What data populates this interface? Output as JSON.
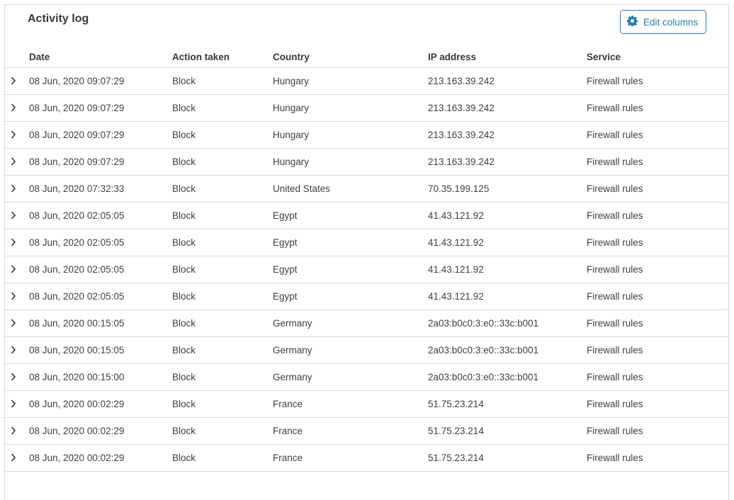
{
  "header": {
    "title": "Activity log",
    "edit_columns_label": "Edit columns",
    "edit_columns_icon": "gear-icon",
    "accent_color": "#2c7cb0"
  },
  "table": {
    "columns": [
      "Date",
      "Action taken",
      "Country",
      "IP address",
      "Service"
    ],
    "rows": [
      {
        "date": "08 Jun, 2020 09:07:29",
        "action": "Block",
        "country": "Hungary",
        "ip": "213.163.39.242",
        "service": "Firewall rules"
      },
      {
        "date": "08 Jun, 2020 09:07:29",
        "action": "Block",
        "country": "Hungary",
        "ip": "213.163.39.242",
        "service": "Firewall rules"
      },
      {
        "date": "08 Jun, 2020 09:07:29",
        "action": "Block",
        "country": "Hungary",
        "ip": "213.163.39.242",
        "service": "Firewall rules"
      },
      {
        "date": "08 Jun, 2020 09:07:29",
        "action": "Block",
        "country": "Hungary",
        "ip": "213.163.39.242",
        "service": "Firewall rules"
      },
      {
        "date": "08 Jun, 2020 07:32:33",
        "action": "Block",
        "country": "United States",
        "ip": "70.35.199.125",
        "service": "Firewall rules"
      },
      {
        "date": "08 Jun, 2020 02:05:05",
        "action": "Block",
        "country": "Egypt",
        "ip": "41.43.121.92",
        "service": "Firewall rules"
      },
      {
        "date": "08 Jun, 2020 02:05:05",
        "action": "Block",
        "country": "Egypt",
        "ip": "41.43.121.92",
        "service": "Firewall rules"
      },
      {
        "date": "08 Jun, 2020 02:05:05",
        "action": "Block",
        "country": "Egypt",
        "ip": "41.43.121.92",
        "service": "Firewall rules"
      },
      {
        "date": "08 Jun, 2020 02:05:05",
        "action": "Block",
        "country": "Egypt",
        "ip": "41.43.121.92",
        "service": "Firewall rules"
      },
      {
        "date": "08 Jun, 2020 00:15:05",
        "action": "Block",
        "country": "Germany",
        "ip": "2a03:b0c0:3:e0::33c:b001",
        "service": "Firewall rules"
      },
      {
        "date": "08 Jun, 2020 00:15:05",
        "action": "Block",
        "country": "Germany",
        "ip": "2a03:b0c0:3:e0::33c:b001",
        "service": "Firewall rules"
      },
      {
        "date": "08 Jun, 2020 00:15:00",
        "action": "Block",
        "country": "Germany",
        "ip": "2a03:b0c0:3:e0::33c:b001",
        "service": "Firewall rules"
      },
      {
        "date": "08 Jun, 2020 00:02:29",
        "action": "Block",
        "country": "France",
        "ip": "51.75.23.214",
        "service": "Firewall rules"
      },
      {
        "date": "08 Jun, 2020 00:02:29",
        "action": "Block",
        "country": "France",
        "ip": "51.75.23.214",
        "service": "Firewall rules"
      },
      {
        "date": "08 Jun, 2020 00:02:29",
        "action": "Block",
        "country": "France",
        "ip": "51.75.23.214",
        "service": "Firewall rules"
      }
    ]
  }
}
